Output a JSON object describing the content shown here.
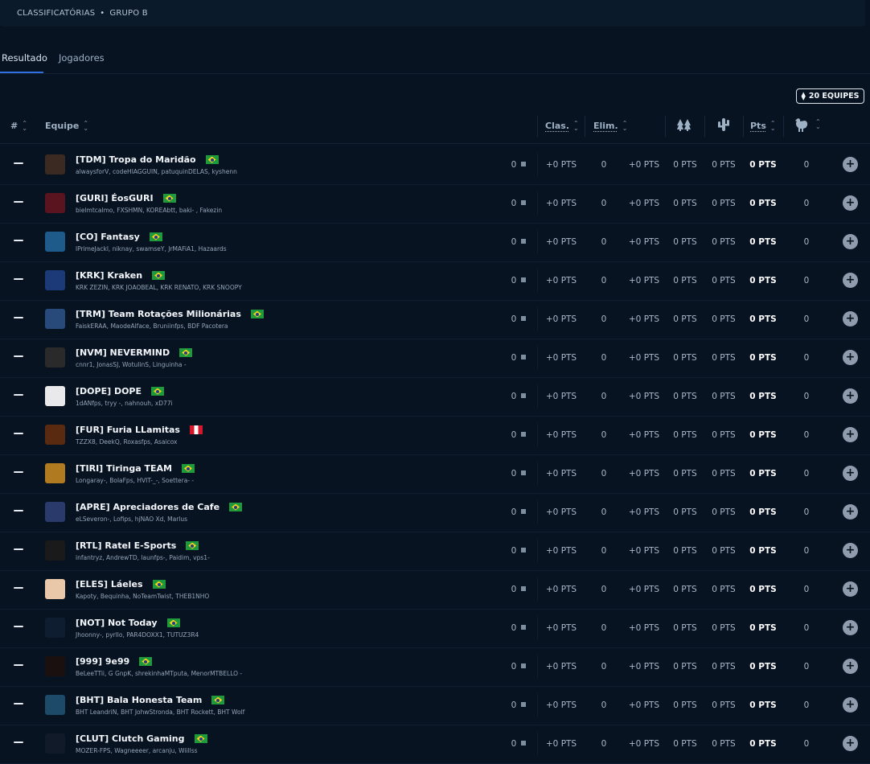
{
  "breadcrumb": {
    "part1": "CLASSIFICATÓRIAS",
    "separator": "•",
    "part2": "GRUPO B"
  },
  "tabs": [
    {
      "label": "Resultado",
      "active": true
    },
    {
      "label": "Jogadores",
      "active": false
    }
  ],
  "team_count_button": {
    "label": "20 EQUIPES"
  },
  "columns": {
    "rank": "#",
    "team": "Equipe",
    "clas": "Clas.",
    "elim": "Elim.",
    "icon1": "tree-icon",
    "icon2": "cactus-icon",
    "pts": "Pts",
    "icon3": "chicken-icon"
  },
  "rows": [
    {
      "name": "[TDM] Tropa do Maridão",
      "flag": "br",
      "players": "alwaysforV, codeHIAGGUIN, patuquinDELAS, kyshenn",
      "clas": "0",
      "clas_pts": "+0 PTS",
      "elim": "0",
      "elim_pts": "+0 PTS",
      "c1": "0 PTS",
      "c2": "0 PTS",
      "pts": "0 PTS",
      "wins": "0"
    },
    {
      "name": "[GURI] ÉosGURI",
      "flag": "br",
      "players": "bielmtcalmo, FXSHMN, KOREAbtt, baki- , Fakezin",
      "clas": "0",
      "clas_pts": "+0 PTS",
      "elim": "0",
      "elim_pts": "+0 PTS",
      "c1": "0 PTS",
      "c2": "0 PTS",
      "pts": "0 PTS",
      "wins": "0"
    },
    {
      "name": "[CO] Fantasy",
      "flag": "br",
      "players": "lPrimeJackl, niknay, swamseY, JrMAFiA1, Hazaards",
      "clas": "0",
      "clas_pts": "+0 PTS",
      "elim": "0",
      "elim_pts": "+0 PTS",
      "c1": "0 PTS",
      "c2": "0 PTS",
      "pts": "0 PTS",
      "wins": "0"
    },
    {
      "name": "[KRK] Kraken",
      "flag": "br",
      "players": "KRK ZEZIN, KRK JOAOBEAL, KRK RENATO, KRK SNOOPY",
      "clas": "0",
      "clas_pts": "+0 PTS",
      "elim": "0",
      "elim_pts": "+0 PTS",
      "c1": "0 PTS",
      "c2": "0 PTS",
      "pts": "0 PTS",
      "wins": "0"
    },
    {
      "name": "[TRM] Team Rotações Milionárias",
      "flag": "br",
      "players": "FaiskERAA, MaodeAlface, Bruniinfps, BDF Pacotera",
      "clas": "0",
      "clas_pts": "+0 PTS",
      "elim": "0",
      "elim_pts": "+0 PTS",
      "c1": "0 PTS",
      "c2": "0 PTS",
      "pts": "0 PTS",
      "wins": "0"
    },
    {
      "name": "[NVM] NEVERMIND",
      "flag": "br",
      "players": "cnnr1, JonasSJ, WotulinS, Linguinha -",
      "clas": "0",
      "clas_pts": "+0 PTS",
      "elim": "0",
      "elim_pts": "+0 PTS",
      "c1": "0 PTS",
      "c2": "0 PTS",
      "pts": "0 PTS",
      "wins": "0"
    },
    {
      "name": "[DOPE] DOPE",
      "flag": "br",
      "players": "1dANfps, tryy -, nahnouh, xD77i",
      "clas": "0",
      "clas_pts": "+0 PTS",
      "elim": "0",
      "elim_pts": "+0 PTS",
      "c1": "0 PTS",
      "c2": "0 PTS",
      "pts": "0 PTS",
      "wins": "0"
    },
    {
      "name": "[FUR] Furia LLamitas",
      "flag": "pe",
      "players": "TZZX8, DeekQ, Roxasfps, Asaicox",
      "clas": "0",
      "clas_pts": "+0 PTS",
      "elim": "0",
      "elim_pts": "+0 PTS",
      "c1": "0 PTS",
      "c2": "0 PTS",
      "pts": "0 PTS",
      "wins": "0"
    },
    {
      "name": "[TIRI] Tiringa TEAM",
      "flag": "br",
      "players": "Longaray-, BolaFps, HVIT-_-, Soettera- -",
      "clas": "0",
      "clas_pts": "+0 PTS",
      "elim": "0",
      "elim_pts": "+0 PTS",
      "c1": "0 PTS",
      "c2": "0 PTS",
      "pts": "0 PTS",
      "wins": "0"
    },
    {
      "name": "[APRE] Apreciadores de Cafe",
      "flag": "br",
      "players": "eLSeveron-, Lofips, hjNAO Xd, Marlus",
      "clas": "0",
      "clas_pts": "+0 PTS",
      "elim": "0",
      "elim_pts": "+0 PTS",
      "c1": "0 PTS",
      "c2": "0 PTS",
      "pts": "0 PTS",
      "wins": "0"
    },
    {
      "name": "[RTL] Ratel E-Sports",
      "flag": "br",
      "players": "infantryz, AndrewTD, launfps-, Paidim, vps1-",
      "clas": "0",
      "clas_pts": "+0 PTS",
      "elim": "0",
      "elim_pts": "+0 PTS",
      "c1": "0 PTS",
      "c2": "0 PTS",
      "pts": "0 PTS",
      "wins": "0"
    },
    {
      "name": "[ELES] Láeles",
      "flag": "br",
      "players": "Kapoty, Bequinha, NoTeamTwist, THEB1NHO",
      "clas": "0",
      "clas_pts": "+0 PTS",
      "elim": "0",
      "elim_pts": "+0 PTS",
      "c1": "0 PTS",
      "c2": "0 PTS",
      "pts": "0 PTS",
      "wins": "0"
    },
    {
      "name": "[NOT] Not Today",
      "flag": "br",
      "players": "Jhoonny-, pyrllo, PAR4DOXX1, TUTUZ3R4",
      "clas": "0",
      "clas_pts": "+0 PTS",
      "elim": "0",
      "elim_pts": "+0 PTS",
      "c1": "0 PTS",
      "c2": "0 PTS",
      "pts": "0 PTS",
      "wins": "0"
    },
    {
      "name": "[999] 9e99",
      "flag": "br",
      "players": "BeLeeTTii, G GnpK, shrekinhaMTputa, MenorMTBELLO -",
      "clas": "0",
      "clas_pts": "+0 PTS",
      "elim": "0",
      "elim_pts": "+0 PTS",
      "c1": "0 PTS",
      "c2": "0 PTS",
      "pts": "0 PTS",
      "wins": "0"
    },
    {
      "name": "[BHT] Bala Honesta Team",
      "flag": "br",
      "players": "BHT LeandriN, BHT JohwStronda, BHT Rockett, BHT Wolf",
      "clas": "0",
      "clas_pts": "+0 PTS",
      "elim": "0",
      "elim_pts": "+0 PTS",
      "c1": "0 PTS",
      "c2": "0 PTS",
      "pts": "0 PTS",
      "wins": "0"
    },
    {
      "name": "[CLUT] Clutch Gaming",
      "flag": "br",
      "players": "MOZER-FPS, Wagneeeer, arcanju, Wiillss",
      "clas": "0",
      "clas_pts": "+0 PTS",
      "elim": "0",
      "elim_pts": "+0 PTS",
      "c1": "0 PTS",
      "c2": "0 PTS",
      "pts": "0 PTS",
      "wins": "0"
    }
  ],
  "colors": {
    "background": "#071321",
    "accent": "#2f6fe0",
    "logo_palette": [
      "#3a2a22",
      "#5a1420",
      "#1e5a8a",
      "#1d3a78",
      "#274a7a",
      "#2a2a2a",
      "#e9e9ec",
      "#5a2a10",
      "#b07a20",
      "#2a3a6a",
      "#1a1a1a",
      "#e8c8a8",
      "#0e1e30",
      "#1a1010",
      "#1e4a6a",
      "#101a28"
    ]
  }
}
